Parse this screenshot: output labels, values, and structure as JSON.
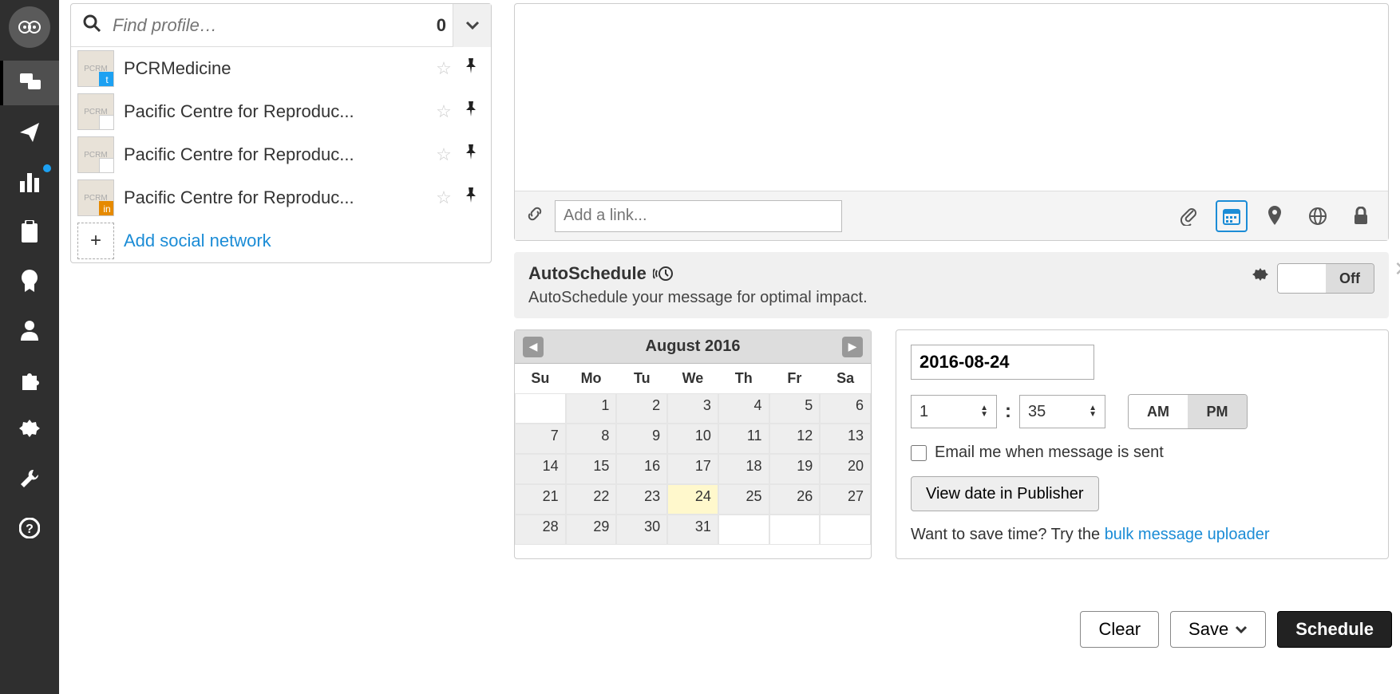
{
  "nav": {
    "items": [
      "streams",
      "publisher",
      "analytics",
      "assignments",
      "campaigns",
      "contacts",
      "apps",
      "settings",
      "tools",
      "help"
    ]
  },
  "profilePicker": {
    "placeholder": "Find profile…",
    "count": "0",
    "profiles": [
      {
        "name": "PCRMedicine",
        "network": "tw"
      },
      {
        "name": "Pacific Centre for Reproduc...",
        "network": "pz"
      },
      {
        "name": "Pacific Centre for Reproduc...",
        "network": "pz"
      },
      {
        "name": "Pacific Centre for Reproduc...",
        "network": "li"
      }
    ],
    "addLabel": "Add social network"
  },
  "composer": {
    "linkPlaceholder": "Add a link..."
  },
  "autoschedule": {
    "title": "AutoSchedule",
    "sub": "AutoSchedule your message for optimal impact.",
    "toggle": "Off"
  },
  "calendar": {
    "title": "August 2016",
    "dow": [
      "Su",
      "Mo",
      "Tu",
      "We",
      "Th",
      "Fr",
      "Sa"
    ],
    "blanksBefore": 1,
    "days": 31,
    "selected": 24
  },
  "time": {
    "date": "2016-08-24",
    "hour": "1",
    "minute": "35",
    "am": "AM",
    "pm": "PM",
    "ampmSelected": "PM",
    "emailLabel": "Email me when message is sent",
    "viewPublisher": "View date in Publisher",
    "tipPrefix": "Want to save time? Try the ",
    "tipLink": "bulk message uploader"
  },
  "buttons": {
    "clear": "Clear",
    "save": "Save",
    "schedule": "Schedule"
  }
}
